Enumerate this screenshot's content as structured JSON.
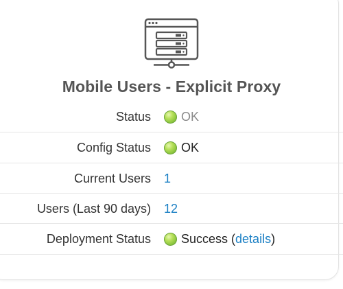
{
  "title": "Mobile Users - Explicit Proxy",
  "icon": "proxy-server-window-icon",
  "colors": {
    "status_ok": "#8cc63f",
    "link": "#1a7fc4",
    "title_text": "#555555"
  },
  "rows": [
    {
      "label": "Status",
      "value": "OK"
    },
    {
      "label": "Config Status",
      "value": "OK"
    },
    {
      "label": "Current Users",
      "value": "1"
    },
    {
      "label": "Users (Last 90 days)",
      "value": "12"
    },
    {
      "label": "Deployment Status",
      "value": "Success",
      "link_text": "details"
    }
  ]
}
